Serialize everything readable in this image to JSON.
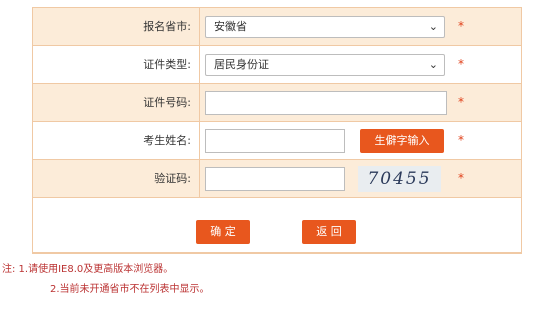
{
  "form": {
    "province": {
      "label": "报名省市:",
      "value": "安徽省"
    },
    "id_type": {
      "label": "证件类型:",
      "value": "居民身份证"
    },
    "id_number": {
      "label": "证件号码:",
      "value": ""
    },
    "name": {
      "label": "考生姓名:",
      "value": "",
      "rare_char_button": "生僻字输入"
    },
    "captcha": {
      "label": "验证码:",
      "value": "",
      "image_text": "70455"
    },
    "required_mark": "*"
  },
  "buttons": {
    "confirm": "确 定",
    "back": "返 回"
  },
  "notes": {
    "line1": "注: 1.请使用IE8.0及更高版本浏览器。",
    "line2": "2.当前未开通省市不在列表中显示。"
  },
  "colors": {
    "accent": "#e8571e",
    "row_alt": "#fcecd9",
    "border": "#f0c9a4"
  }
}
